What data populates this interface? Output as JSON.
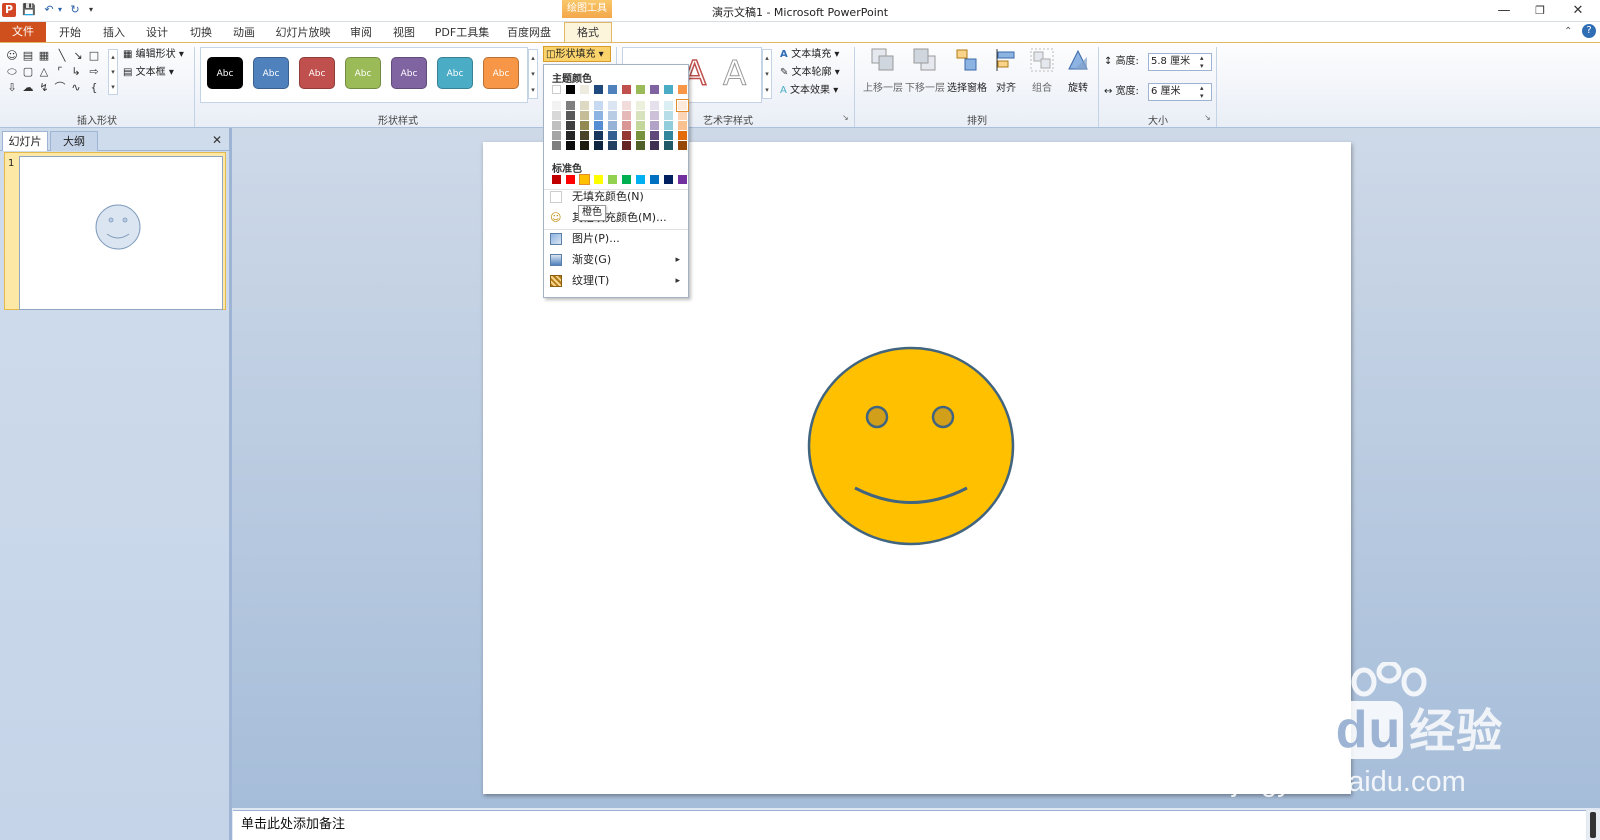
{
  "window": {
    "title": "演示文稿1 - Microsoft PowerPoint",
    "context_tab": "绘图工具"
  },
  "tabs": {
    "file": "文件",
    "items": [
      "开始",
      "插入",
      "设计",
      "切换",
      "动画",
      "幻灯片放映",
      "审阅",
      "视图",
      "PDF工具集",
      "百度网盘",
      "格式"
    ],
    "active": "格式"
  },
  "ribbon": {
    "insert_shapes": {
      "label": "插入形状",
      "edit_shape": "编辑形状",
      "text_box": "文本框"
    },
    "shape_styles": {
      "label": "形状样式",
      "swatch_text": "Abc",
      "swatch_colors": [
        "#000000",
        "#4f81bd",
        "#c0504d",
        "#9bbb59",
        "#8064a2",
        "#4bacc6",
        "#f79646"
      ],
      "shape_fill": "形状填充"
    },
    "wordart": {
      "label": "艺术字样式",
      "text_fill": "文本填充",
      "text_outline": "文本轮廓",
      "text_effects": "文本效果"
    },
    "arrange": {
      "label": "排列",
      "bring_forward": "上移一层",
      "send_backward": "下移一层",
      "selection_pane": "选择窗格",
      "align": "对齐",
      "group": "组合",
      "rotate": "旋转"
    },
    "size": {
      "label": "大小",
      "height_label": "高度:",
      "height_value": "5.8 厘米",
      "width_label": "宽度:",
      "width_value": "6 厘米"
    }
  },
  "fill_menu": {
    "theme_colors_label": "主题颜色",
    "standard_colors_label": "标准色",
    "theme_top_row": [
      "#ffffff",
      "#000000",
      "#eeece1",
      "#1f497d",
      "#4f81bd",
      "#c0504d",
      "#9bbb59",
      "#8064a2",
      "#4bacc6",
      "#f79646"
    ],
    "theme_columns": [
      [
        "#f2f2f2",
        "#d8d8d8",
        "#bfbfbf",
        "#a5a5a5",
        "#7f7f7f"
      ],
      [
        "#7f7f7f",
        "#595959",
        "#3f3f3f",
        "#262626",
        "#0c0c0c"
      ],
      [
        "#ddd9c3",
        "#c4bd97",
        "#938953",
        "#494429",
        "#1d1b10"
      ],
      [
        "#c6d9f0",
        "#8db3e2",
        "#548dd4",
        "#17365d",
        "#0f243e"
      ],
      [
        "#dbe5f1",
        "#b8cce4",
        "#95b3d7",
        "#366092",
        "#244061"
      ],
      [
        "#f2dcdb",
        "#e5b9b7",
        "#d99694",
        "#953734",
        "#632423"
      ],
      [
        "#ebf1dd",
        "#d7e3bc",
        "#c3d69b",
        "#76923c",
        "#4f6128"
      ],
      [
        "#e5e0ec",
        "#ccc1d9",
        "#b2a2c7",
        "#5f497a",
        "#3f3151"
      ],
      [
        "#dbeef3",
        "#b7dde8",
        "#92cddc",
        "#31859b",
        "#205867"
      ],
      [
        "#fdeada",
        "#fbd5b5",
        "#fac08f",
        "#e36c09",
        "#974806"
      ]
    ],
    "standard_colors": [
      "#c00000",
      "#ff0000",
      "#ffc000",
      "#ffff00",
      "#92d050",
      "#00b050",
      "#00b0f0",
      "#0070c0",
      "#002060",
      "#7030a0"
    ],
    "no_fill": "无填充颜色(N)",
    "more_colors": "其他填充颜色(M)...",
    "picture": "图片(P)...",
    "gradient": "渐变(G)",
    "texture": "纹理(T)",
    "tooltip": "橙色"
  },
  "left_panel": {
    "tab_slides": "幻灯片",
    "tab_outline": "大纲",
    "slide_number": "1"
  },
  "smiley": {
    "face_color": "#ffc000",
    "outline_color": "#41647f"
  },
  "notes": {
    "placeholder": "单击此处添加备注"
  },
  "watermark": {
    "brand": "Bai",
    "brand_du": "du",
    "brand_cn": "经验",
    "url": "jingyan.baidu.com"
  }
}
